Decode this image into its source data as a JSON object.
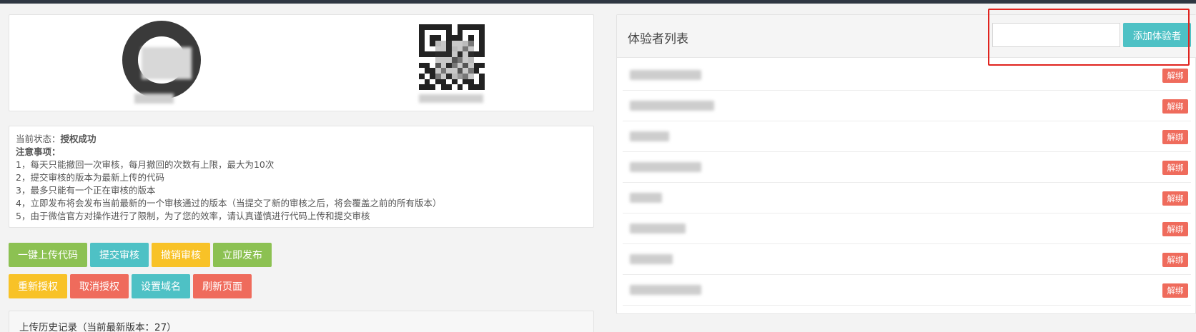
{
  "status": {
    "label": "当前状态：",
    "value": "授权成功"
  },
  "notes": {
    "title": "注意事项：",
    "items": [
      "1，每天只能撤回一次审核，每月撤回的次数有上限，最大为10次",
      "2，提交审核的版本为最新上传的代码",
      "3，最多只能有一个正在审核的版本",
      "4，立即发布将会发布当前最新的一个审核通过的版本（当提交了新的审核之后，将会覆盖之前的所有版本）",
      "5，由于微信官方对操作进行了限制，为了您的效率，请认真谨慎进行代码上传和提交审核"
    ]
  },
  "actions": {
    "upload": "一键上传代码",
    "submit": "提交审核",
    "withdraw": "撤销审核",
    "publish": "立即发布",
    "reauth": "重新授权",
    "cancel_auth": "取消授权",
    "set_domain": "设置域名",
    "refresh": "刷新页面"
  },
  "history": {
    "title": "上传历史记录（当前最新版本：27）"
  },
  "testers": {
    "title": "体验者列表",
    "input_value": "",
    "add_label": "添加体验者",
    "unbind_label": "解绑",
    "count": 8
  },
  "colors": {
    "green": "#8cc152",
    "teal": "#4ec1c5",
    "yellow": "#f8c227",
    "red": "#ef6b5c",
    "highlight": "#e0231e"
  }
}
